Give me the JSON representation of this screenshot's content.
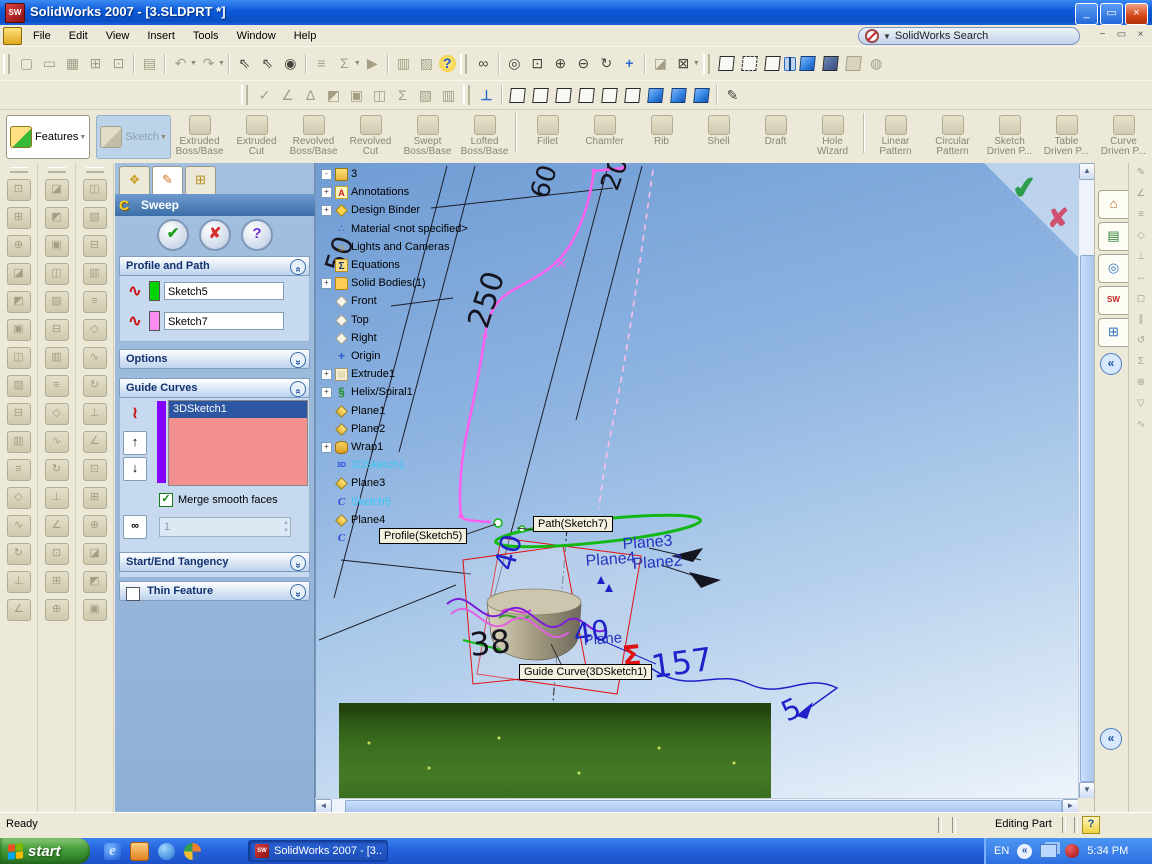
{
  "colors": {
    "titlebar_blue": "#0c59d8",
    "toolbar_bg": "#ece9d8",
    "panel_blue": "#9ab8dc",
    "header_navy": "#10316e",
    "listbox_salmon": "#f29090",
    "selection_navy": "#2c55a2",
    "profile_swatch_green": "#00d400",
    "path_swatch_pink": "#ff8af0",
    "guide_bar_purple": "#8400ff",
    "sky_top": "#6f9cd4",
    "dim_blue": "#2021c8",
    "dim_red": "#e01010",
    "path_magenta": "#ff5ff0",
    "ellipse_green": "#14b814"
  },
  "titlebar": {
    "title": "SolidWorks 2007 - [3.SLDPRT *]"
  },
  "menubar": {
    "menus": [
      "File",
      "Edit",
      "View",
      "Insert",
      "Tools",
      "Window",
      "Help"
    ],
    "search_label": "SolidWorks Search"
  },
  "features_bar": {
    "features": "Features",
    "sketch": "Sketch",
    "overflow": "»",
    "buttons": [
      {
        "label": "Extruded Boss/Base",
        "icon": "extruded-boss-base-icon"
      },
      {
        "label": "Extruded Cut",
        "icon": "extruded-cut-icon"
      },
      {
        "label": "Revolved Boss/Base",
        "icon": "revolved-boss-base-icon"
      },
      {
        "label": "Revolved Cut",
        "icon": "revolved-cut-icon"
      },
      {
        "label": "Swept Boss/Base",
        "icon": "swept-boss-base-icon"
      },
      {
        "label": "Lofted Boss/Base",
        "icon": "lofted-boss-base-icon"
      },
      {
        "label": "Fillet",
        "icon": "fillet-icon",
        "sep": true
      },
      {
        "label": "Chamfer",
        "icon": "chamfer-icon"
      },
      {
        "label": "Rib",
        "icon": "rib-icon"
      },
      {
        "label": "Shell",
        "icon": "shell-icon"
      },
      {
        "label": "Draft",
        "icon": "draft-icon"
      },
      {
        "label": "Hole Wizard",
        "icon": "hole-wizard-icon"
      },
      {
        "label": "Linear Pattern",
        "icon": "linear-pattern-icon",
        "sep": true
      },
      {
        "label": "Circular Pattern",
        "icon": "circular-pattern-icon"
      },
      {
        "label": "Sketch Driven P...",
        "icon": "sketch-driven-pattern-icon"
      },
      {
        "label": "Table Driven P...",
        "icon": "table-driven-pattern-icon"
      },
      {
        "label": "Curve Driven P...",
        "icon": "curve-driven-pattern-icon"
      }
    ]
  },
  "property_manager": {
    "title": "Sweep",
    "profile_path": {
      "header": "Profile and Path",
      "profile_value": "Sketch5",
      "path_value": "Sketch7"
    },
    "options_header": "Options",
    "guide_curves": {
      "header": "Guide Curves",
      "list": [
        "3DSketch1"
      ],
      "merge_label": "Merge smooth faces",
      "sections_value": "1"
    },
    "tangency_header": "Start/End Tangency",
    "thin_header": "Thin Feature"
  },
  "tree": {
    "items": [
      {
        "exp": "-",
        "icon": "part",
        "label": "3"
      },
      {
        "exp": "+",
        "icon": "annotations",
        "label": "Annotations"
      },
      {
        "exp": "+",
        "icon": "design-binder",
        "label": "Design Binder"
      },
      {
        "exp": "",
        "icon": "material",
        "label": "Material <not specified>"
      },
      {
        "exp": "",
        "icon": "lights",
        "label": "Lights and Cameras"
      },
      {
        "exp": "",
        "icon": "equations",
        "label": "Equations"
      },
      {
        "exp": "+",
        "icon": "solid-bodies",
        "label": "Solid Bodies(1)"
      },
      {
        "exp": "",
        "icon": "ref-plane",
        "label": "Front"
      },
      {
        "exp": "",
        "icon": "ref-plane",
        "label": "Top"
      },
      {
        "exp": "",
        "icon": "ref-plane",
        "label": "Right"
      },
      {
        "exp": "",
        "icon": "origin",
        "label": "Origin"
      },
      {
        "exp": "+",
        "icon": "extrude",
        "label": "Extrude1"
      },
      {
        "exp": "+",
        "icon": "helix",
        "label": "Helix/Spiral1"
      },
      {
        "exp": "",
        "icon": "plane",
        "label": "Plane1"
      },
      {
        "exp": "",
        "icon": "plane",
        "label": "Plane2"
      },
      {
        "exp": "+",
        "icon": "wrap",
        "label": "Wrap1"
      },
      {
        "exp": "",
        "icon": "sketch3d",
        "label": "3DSketch1",
        "hl": true
      },
      {
        "exp": "",
        "icon": "plane",
        "label": "Plane3"
      },
      {
        "exp": "",
        "icon": "sketch",
        "label": "Sketch5",
        "hl": true
      },
      {
        "exp": "",
        "icon": "plane",
        "label": "Plane4"
      },
      {
        "exp": "",
        "icon": "sketch",
        "label": ""
      }
    ]
  },
  "viewport": {
    "dims": {
      "d60": "60",
      "d20": "20",
      "d50": "50",
      "d250": "250",
      "d40a": "40",
      "d38": "38",
      "d40b": "40",
      "sigma": "Σ",
      "d157": "157",
      "d5": "5"
    },
    "plane_labels": {
      "p3": "Plane3",
      "p4": "Plane4",
      "p2": "Plane2",
      "p1": "Plane"
    },
    "callouts": {
      "profile": "Profile(Sketch5)",
      "path": "Path(Sketch7)",
      "guide": "Guide Curve(3DSketch1)"
    }
  },
  "side_toolbars": {
    "left_columns": 3,
    "icons_per_column": 16,
    "right_icons": 13
  },
  "status_bar": {
    "ready": "Ready",
    "mode": "Editing Part",
    "help": "?"
  },
  "taskbar": {
    "start": "start",
    "task": "SolidWorks 2007 - [3....",
    "lang": "EN",
    "time": "5:34 PM"
  }
}
